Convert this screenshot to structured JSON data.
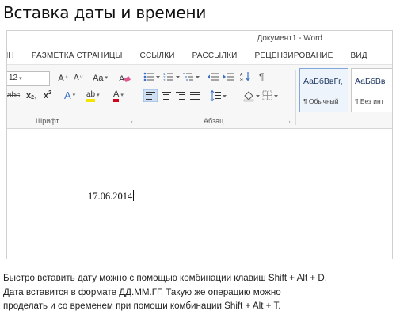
{
  "page_title": "Вставка даты и времени",
  "window": {
    "title": "Документ1 - Word"
  },
  "tabs": [
    {
      "label": "ЙН"
    },
    {
      "label": "РАЗМЕТКА СТРАНИЦЫ"
    },
    {
      "label": "ССЫЛКИ"
    },
    {
      "label": "РАССЫЛКИ"
    },
    {
      "label": "РЕЦЕНЗИРОВАНИЕ"
    },
    {
      "label": "ВИД"
    }
  ],
  "ribbon": {
    "font": {
      "size_value": "12",
      "grow_label": "A",
      "shrink_label": "A",
      "case_label": "Aa",
      "strike_label": "abc",
      "subscript_label": "x",
      "superscript_label": "x",
      "text_effects_label": "A",
      "highlight_label": "ab",
      "font_color_label": "A",
      "group_label": "Шрифт"
    },
    "paragraph": {
      "group_label": "Абзац",
      "pilcrow": "¶"
    },
    "styles": [
      {
        "sample": "АаБбВвГг,",
        "name": "¶ Обычный",
        "selected": true
      },
      {
        "sample": "АаБбВв",
        "name": "¶ Без инт",
        "selected": false
      }
    ],
    "colors": {
      "highlight": "#f5e400",
      "font_color": "#d0021b",
      "text_effect": "#3a6fc4",
      "selection": "#7ea8d8"
    }
  },
  "document": {
    "text": "17.06.2014"
  },
  "caption": {
    "line1": "Быстро вставить дату можно с помощью комбинации клавиш Shift + Alt + D.",
    "line2": "Дата вставится в формате ДД.ММ.ГГ. Такую же операцию можно",
    "line3": "проделать и со временем при помощи комбинации Shift + Alt + T."
  }
}
